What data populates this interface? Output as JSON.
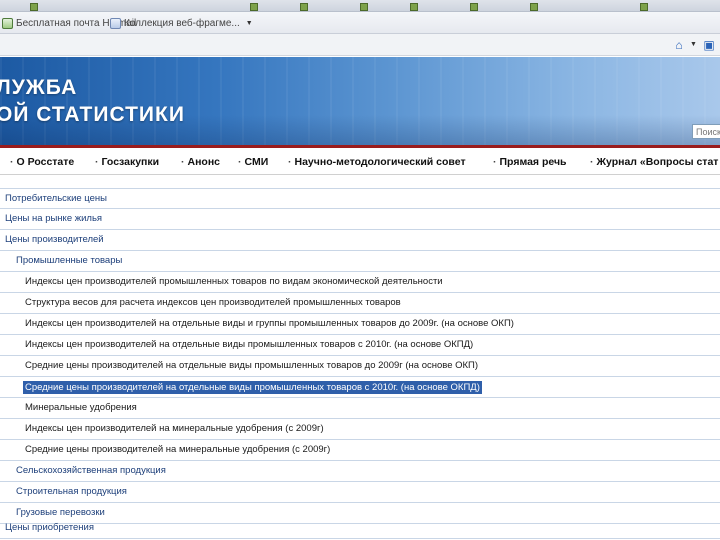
{
  "browser": {
    "favorites": [
      {
        "label": "Бесплатная почта Hotmail"
      },
      {
        "label": "Коллекция веб-фрагме..."
      }
    ]
  },
  "banner": {
    "title_line1": "ЛУЖБА",
    "title_line2": "ОЙ СТАТИСТИКИ",
    "search_placeholder": "Поиск"
  },
  "nav": {
    "items": [
      {
        "label": "О Росстате"
      },
      {
        "label": "Госзакупки"
      },
      {
        "label": "Анонс"
      },
      {
        "label": "СМИ"
      },
      {
        "label": "Научно-методологический совет"
      },
      {
        "label": "Прямая речь"
      },
      {
        "label": "Журнал «Вопросы стат"
      }
    ]
  },
  "tree": {
    "items": [
      {
        "label": "Потребительские цены",
        "level": 0
      },
      {
        "label": "Цены на рынке жилья",
        "level": 0
      },
      {
        "label": "Цены производителей",
        "level": 0
      },
      {
        "label": "Промышленные товары",
        "level": 1
      },
      {
        "label": "Индексы цен производителей промышленных товаров по видам экономической деятельности",
        "level": 2
      },
      {
        "label": "Структура весов для расчета индексов цен производителей промышленных товаров",
        "level": 2
      },
      {
        "label": "Индексы цен производителей на отдельные виды и группы промышленных товаров до 2009г. (на основе ОКП)",
        "level": 2
      },
      {
        "label": "Индексы цен производителей на отдельные виды промышленных товаров с 2010г. (на основе ОКПД)",
        "level": 2
      },
      {
        "label": "Средние цены производителей на отдельные виды промышленных товаров до 2009г (на основе ОКП)",
        "level": 2
      },
      {
        "label": "Средние цены производителей на отдельные виды промышленных товаров с 2010г. (на основе ОКПД)",
        "level": 2,
        "selected": true
      },
      {
        "label": "Минеральные удобрения",
        "level": 2
      },
      {
        "label": "Индексы цен производителей на минеральные удобрения (с 2009г)",
        "level": 2
      },
      {
        "label": "Средние цены производителей на минеральные удобрения (с 2009г)",
        "level": 2
      },
      {
        "label": "Сельскохозяйственная продукция",
        "level": 1
      },
      {
        "label": "Строительная продукция",
        "level": 1
      },
      {
        "label": "Грузовые перевозки",
        "level": 1
      },
      {
        "label": "Цены приобретения",
        "level": 0
      }
    ]
  }
}
